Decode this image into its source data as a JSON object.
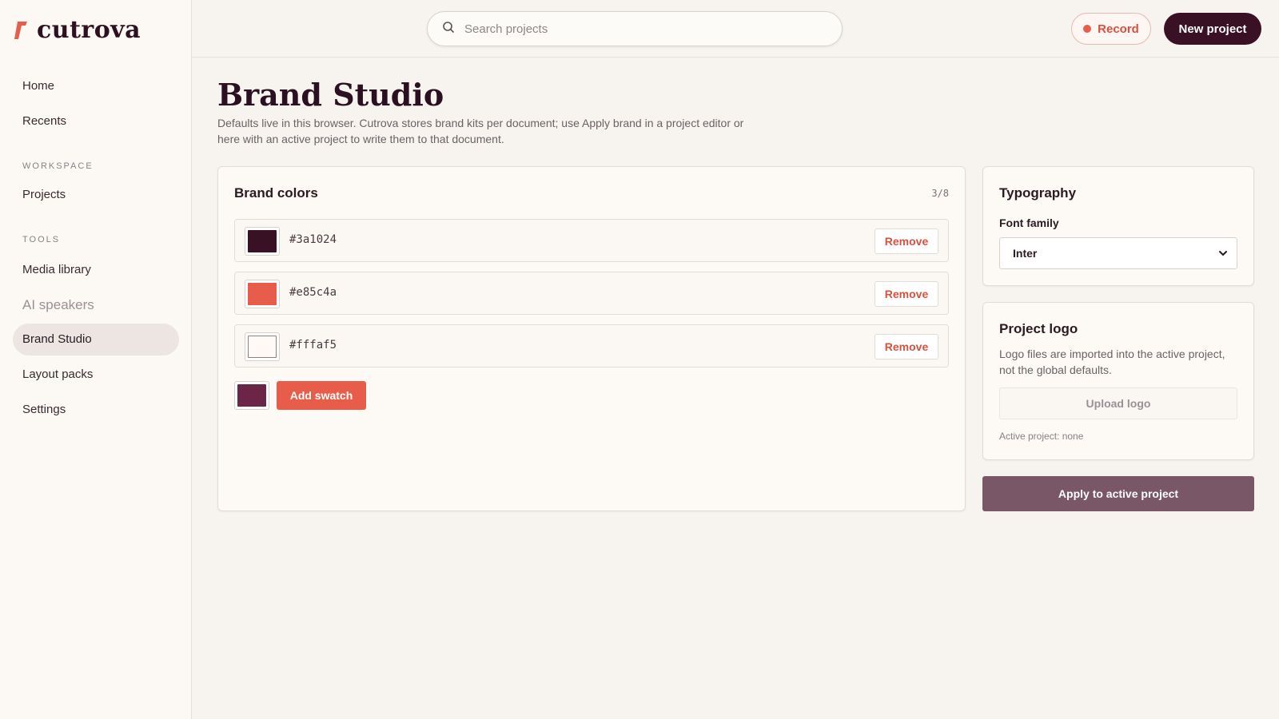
{
  "app": {
    "name": "cutrova",
    "brand_color": "#e85c4a",
    "dark_color": "#3a1024"
  },
  "sidebar": {
    "items_top": [
      {
        "label": "Home"
      },
      {
        "label": "Recents"
      }
    ],
    "workspace_heading": "WORKSPACE",
    "workspace_items": [
      {
        "label": "Projects"
      }
    ],
    "tools_heading": "TOOLS",
    "tools_items": [
      {
        "label": "Media library"
      },
      {
        "label": "AI speakers"
      },
      {
        "label": "Brand Studio",
        "active": true
      },
      {
        "label": "Layout packs"
      },
      {
        "label": "Settings"
      }
    ]
  },
  "topbar": {
    "search_placeholder": "Search projects",
    "search_value": "",
    "record_label": "Record",
    "new_project_label": "New project"
  },
  "page": {
    "title": "Brand Studio",
    "description": "Defaults live in this browser. Cutrova stores brand kits per document; use Apply brand in a project editor or here with an active project to write them to that document."
  },
  "brand_colors": {
    "title": "Brand colors",
    "counter": "3/8",
    "swatches": [
      {
        "hex": "#3a1024",
        "remove_label": "Remove"
      },
      {
        "hex": "#e85c4a",
        "remove_label": "Remove"
      },
      {
        "hex": "#fffaf5",
        "remove_label": "Remove"
      }
    ],
    "new_swatch_color": "#6b2546",
    "add_label": "Add swatch"
  },
  "typography": {
    "title": "Typography",
    "font_family_label": "Font family",
    "font_family_value": "Inter"
  },
  "project_logo": {
    "title": "Project logo",
    "description": "Logo files are imported into the active project, not the global defaults.",
    "upload_label": "Upload logo",
    "active_project": "Active project: none"
  },
  "apply_label": "Apply to active project"
}
